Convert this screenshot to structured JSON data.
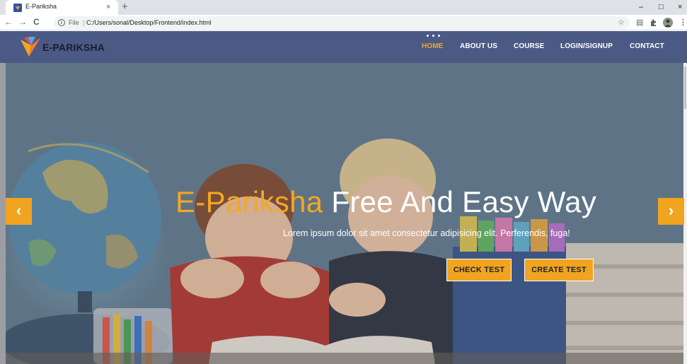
{
  "browser": {
    "tab_title": "E-Pariksha",
    "close_glyph": "×",
    "new_tab_glyph": "+",
    "url_scheme": "File",
    "url_separator": "|",
    "url": "C:/Users/sonal/Desktop/Frontend/index.html",
    "window": {
      "minimize": "–",
      "maximize": "□",
      "close": "×"
    },
    "nav": {
      "back": "←",
      "forward": "→",
      "reload": "C"
    }
  },
  "site": {
    "logo": "E-PARIKSHA",
    "nav": [
      {
        "label": "HOME",
        "active": true
      },
      {
        "label": "ABOUT US",
        "active": false
      },
      {
        "label": "COURSE",
        "active": false
      },
      {
        "label": "LOGIN/SIGNUP",
        "active": false
      },
      {
        "label": "CONTACT",
        "active": false
      }
    ],
    "hero": {
      "headline_accent": "E-Pariksha",
      "headline_rest": " Free And Easy Way",
      "subtitle": "Lorem ipsum dolor sit amet consectetur adipisicing elit. Perferendis, fuga!",
      "buttons": [
        "CHECK TEST",
        "CREATE TEST"
      ],
      "prev": "‹",
      "next": "›"
    }
  },
  "colors": {
    "accent": "#f5a623",
    "button": "#f1a41f",
    "navbar": "#4b5a85"
  }
}
